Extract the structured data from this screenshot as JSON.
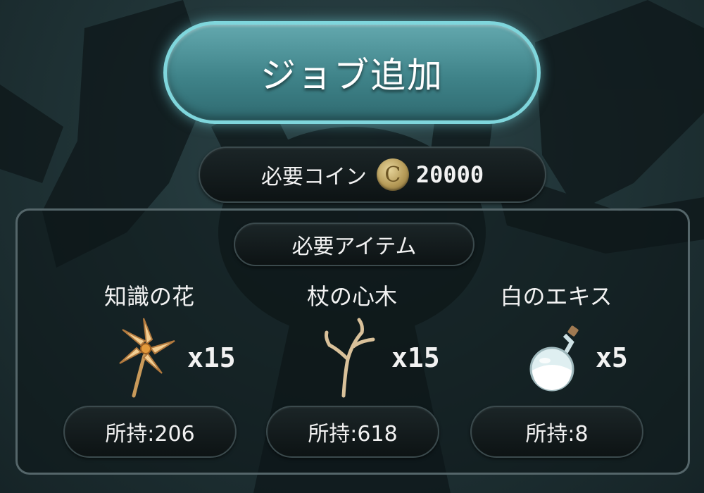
{
  "action": {
    "add_job_label": "ジョブ追加"
  },
  "cost": {
    "label": "必要コイン",
    "coin_symbol": "C",
    "amount": "20000"
  },
  "items": {
    "header": "必要アイテム",
    "list": [
      {
        "name": "知識の花",
        "quantity": "x15",
        "owned": "所持:206",
        "icon": "flower-icon"
      },
      {
        "name": "杖の心木",
        "quantity": "x15",
        "owned": "所持:618",
        "icon": "branch-icon"
      },
      {
        "name": "白のエキス",
        "quantity": "x5",
        "owned": "所持:8",
        "icon": "potion-flask-icon"
      }
    ]
  },
  "colors": {
    "button_fill": "#4b9096",
    "button_glow": "#7fd6dc",
    "background": "#1f3235",
    "pill_fill": "#111a1c"
  }
}
